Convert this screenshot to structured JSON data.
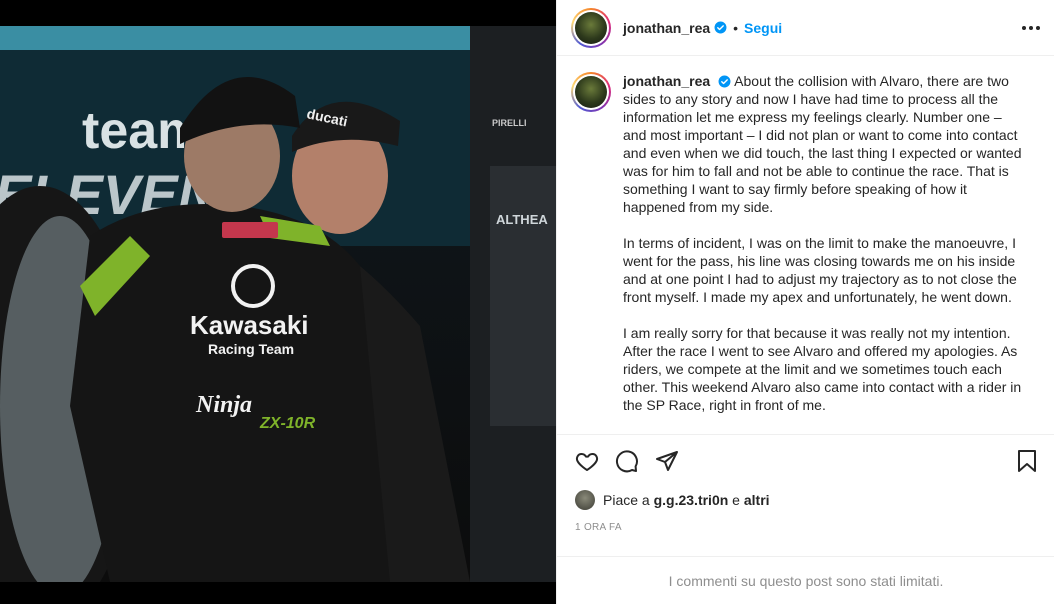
{
  "header": {
    "username": "jonathan_rea",
    "separator": "•",
    "follow_label": "Segui"
  },
  "caption": {
    "username": "jonathan_rea",
    "paragraphs": [
      "About the collision with Alvaro, there are two sides to any story and now I have had time to process all the information let me express my feelings clearly. Number one – and most important – I did not plan or want to come into contact and even when we did touch, the last thing I expected or wanted was for him to fall and not be able to continue the race. That is something I want to say firmly before speaking of how it happened from my side.",
      "In terms of incident, I was on the limit to make the manoeuvre, I went for the pass, his line was closing towards me on his inside and at one point I had to adjust my trajectory as to not close the front myself. I made my apex and unfortunately, he went down.",
      "I am really sorry for that because it was really not my intention. After the race I went to see Alvaro and offered my apologies. As riders, we compete at the limit and we sometimes touch each other. This weekend Alvaro also came into contact with a rider in the SP Race, right in front of me."
    ]
  },
  "photo": {
    "texts": {
      "team": "team",
      "eleven": "ELEVEN",
      "kawasaki": "Kawasaki",
      "racing_team": "Racing Team",
      "ninja": "Ninja",
      "zx10r": "ZX-10R",
      "althea": "ALTHEA",
      "pirelli": "PIRELLI",
      "ducati": "ducati"
    }
  },
  "likes": {
    "prefix": "Piace a",
    "user": "g.g.23.tri0n",
    "conjunction": "e",
    "others": "altri"
  },
  "timestamp": "1 ORA FA",
  "comments_limited": "I commenti su questo post sono stati limitati.",
  "icons": [
    "verified-badge-icon",
    "more-options-icon",
    "heart-icon",
    "comment-icon",
    "share-icon",
    "bookmark-icon"
  ],
  "colors": {
    "accent": "#0095f6",
    "muted": "#8e8e8e",
    "text": "#262626",
    "border": "#efefef"
  }
}
